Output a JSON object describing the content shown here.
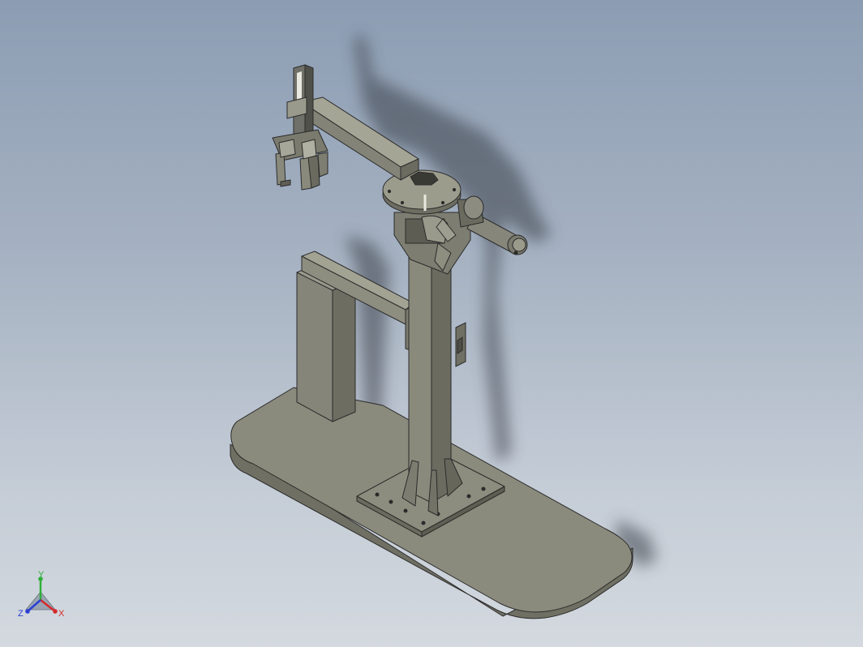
{
  "viewport": {
    "background_top": "#8c9db3",
    "background_bottom": "#d4d9df"
  },
  "model": {
    "parts": [
      "base-plate",
      "column",
      "column-foot-plate",
      "rotary-table",
      "horizontal-arm",
      "servo-motor",
      "gripper",
      "vertical-slide",
      "side-block",
      "cross-brace"
    ],
    "part_color": "#8a8a7a",
    "edge_color": "#2b2b2b"
  },
  "triad": {
    "x_label": "X",
    "y_label": "Y",
    "z_label": "Z",
    "x_color": "#d42a2a",
    "y_color": "#2fae3a",
    "z_color": "#2a3fd4"
  }
}
